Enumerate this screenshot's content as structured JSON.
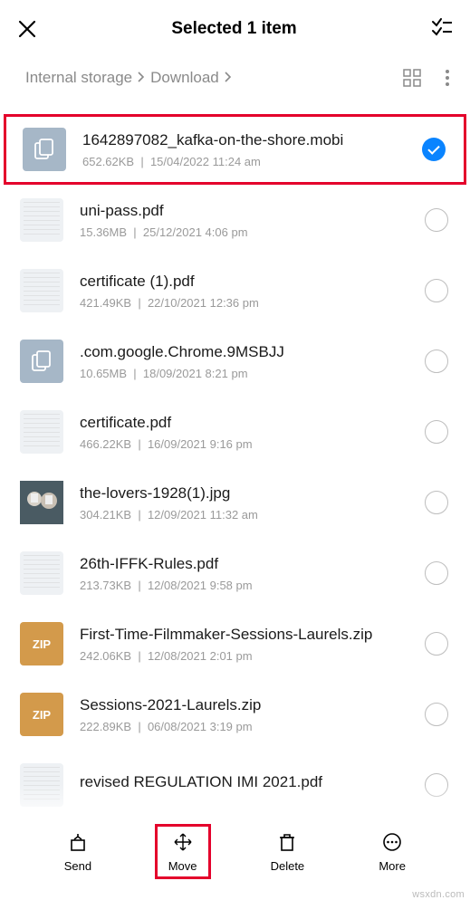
{
  "header": {
    "title": "Selected 1 item"
  },
  "breadcrumb": {
    "root": "Internal storage",
    "folder": "Download"
  },
  "files": [
    {
      "name": "1642897082_kafka-on-the-shore.mobi",
      "size": "652.62KB",
      "date": "15/04/2022 11:24 am",
      "thumb": "generic",
      "thumb_label": "",
      "selected": true
    },
    {
      "name": "uni-pass.pdf",
      "size": "15.36MB",
      "date": "25/12/2021 4:06 pm",
      "thumb": "doc",
      "thumb_label": "",
      "selected": false
    },
    {
      "name": "certificate (1).pdf",
      "size": "421.49KB",
      "date": "22/10/2021 12:36 pm",
      "thumb": "doc",
      "thumb_label": "",
      "selected": false
    },
    {
      "name": ".com.google.Chrome.9MSBJJ",
      "size": "10.65MB",
      "date": "18/09/2021 8:21 pm",
      "thumb": "generic",
      "thumb_label": "",
      "selected": false
    },
    {
      "name": "certificate.pdf",
      "size": "466.22KB",
      "date": "16/09/2021 9:16 pm",
      "thumb": "doc",
      "thumb_label": "",
      "selected": false
    },
    {
      "name": "the-lovers-1928(1).jpg",
      "size": "304.21KB",
      "date": "12/09/2021 11:32 am",
      "thumb": "img",
      "thumb_label": "",
      "selected": false
    },
    {
      "name": "26th-IFFK-Rules.pdf",
      "size": "213.73KB",
      "date": "12/08/2021 9:58 pm",
      "thumb": "doc",
      "thumb_label": "",
      "selected": false
    },
    {
      "name": "First-Time-Filmmaker-Sessions-Laurels.zip",
      "size": "242.06KB",
      "date": "12/08/2021 2:01 pm",
      "thumb": "zip",
      "thumb_label": "ZIP",
      "selected": false
    },
    {
      "name": "Sessions-2021-Laurels.zip",
      "size": "222.89KB",
      "date": "06/08/2021 3:19 pm",
      "thumb": "zip",
      "thumb_label": "ZIP",
      "selected": false
    },
    {
      "name": "revised REGULATION IMI 2021.pdf",
      "size": "",
      "date": "",
      "thumb": "doc",
      "thumb_label": "",
      "selected": false
    }
  ],
  "bottom": {
    "send": "Send",
    "move": "Move",
    "delete": "Delete",
    "more": "More"
  },
  "watermark": "wsxdn.com"
}
